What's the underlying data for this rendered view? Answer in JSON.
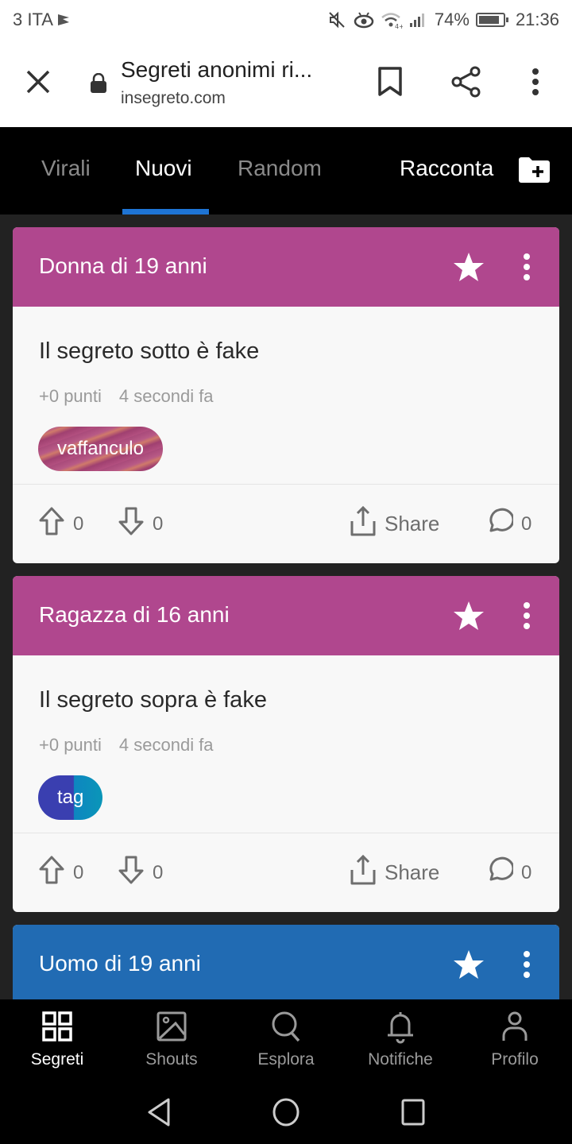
{
  "status_bar": {
    "carrier": "3 ITA",
    "battery": "74%",
    "time": "21:36",
    "icons": [
      "carrier-flag-icon",
      "mute-icon",
      "eye-icon",
      "wifi-icon",
      "signal-icon",
      "battery-icon"
    ]
  },
  "browser": {
    "page_title": "Segreti anonimi ri...",
    "url": "insegreto.com",
    "icons": [
      "close-icon",
      "lock-icon",
      "bookmark-icon",
      "share-icon",
      "more-vert-icon"
    ]
  },
  "tabs": {
    "items": [
      {
        "label": "Virali",
        "active": false
      },
      {
        "label": "Nuovi",
        "active": true
      },
      {
        "label": "Random",
        "active": false
      }
    ],
    "racconta_label": "Racconta",
    "accent": "#1e74d4"
  },
  "posts": [
    {
      "author": "Donna di 19 anni",
      "header_color": "#b0478e",
      "text": "Il segreto sotto è fake",
      "points": "+0 punti",
      "time": "4 secondi fa",
      "tag": "vaffanculo",
      "upvotes": "0",
      "downvotes": "0",
      "share_label": "Share",
      "comments": "0"
    },
    {
      "author": "Ragazza di 16 anni",
      "header_color": "#b0478e",
      "text": "Il segreto sopra è fake",
      "points": "+0 punti",
      "time": "4 secondi fa",
      "tag": "tag",
      "upvotes": "0",
      "downvotes": "0",
      "share_label": "Share",
      "comments": "0"
    },
    {
      "author": "Uomo di 19 anni",
      "header_color": "#216bb3"
    }
  ],
  "bottom_nav": [
    {
      "label": "Segreti",
      "icon": "grid-icon",
      "active": true
    },
    {
      "label": "Shouts",
      "icon": "image-icon",
      "active": false
    },
    {
      "label": "Esplora",
      "icon": "search-icon",
      "active": false
    },
    {
      "label": "Notifiche",
      "icon": "bell-icon",
      "active": false
    },
    {
      "label": "Profilo",
      "icon": "person-icon",
      "active": false
    }
  ],
  "system_nav": [
    "back-icon",
    "home-icon",
    "recents-icon"
  ]
}
